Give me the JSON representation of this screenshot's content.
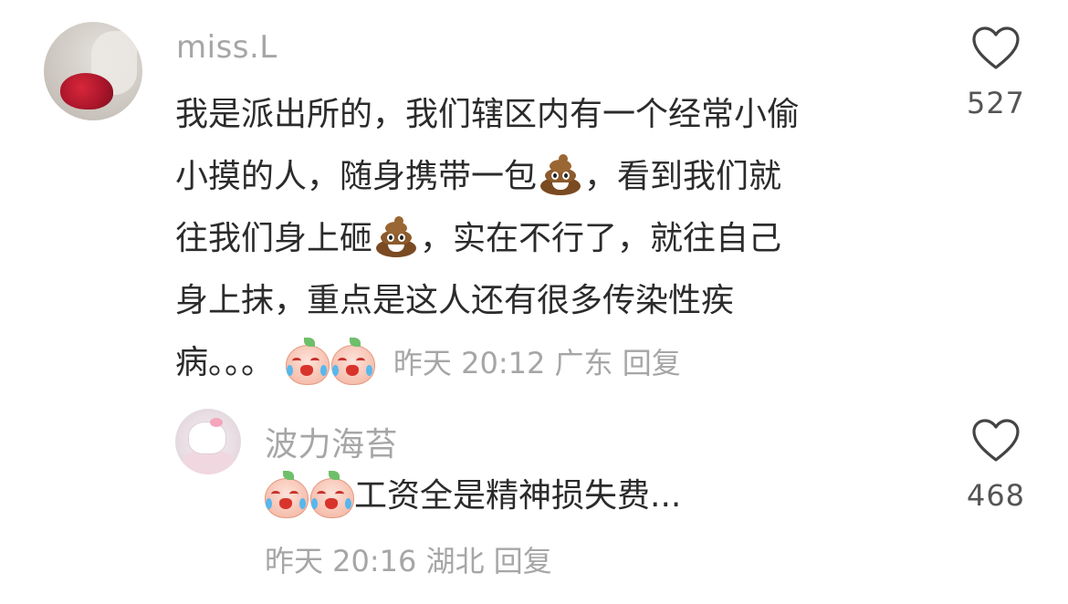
{
  "main_comment": {
    "username": "miss.L",
    "lines": [
      {
        "pre": "我是派出所的，我们辖区内有一个经常小偷",
        "emoji": null,
        "post": ""
      },
      {
        "pre": "小摸的人，随身携带一包",
        "emoji": "poop-icon",
        "post": "，看到我们就"
      },
      {
        "pre": "往我们身上砸",
        "emoji": "poop-icon",
        "post": "，实在不行了，就往自己"
      },
      {
        "pre": "身上抹，重点是这人还有很多传染性疾",
        "emoji": null,
        "post": ""
      },
      {
        "pre": "病。。。",
        "emoji": null,
        "post": ""
      }
    ],
    "time": "昨天 20:12",
    "location": "广东",
    "reply_label": "回复",
    "like_count": "527"
  },
  "reply": {
    "username": "波力海苔",
    "text": "工资全是精神损失费...",
    "time": "昨天 20:16",
    "location": "湖北",
    "reply_label": "回复",
    "like_count": "468"
  },
  "colors": {
    "text_primary": "#2b2b2b",
    "text_meta": "#a6a6a6",
    "like_count": "#555555",
    "heart_stroke": "#444444"
  }
}
